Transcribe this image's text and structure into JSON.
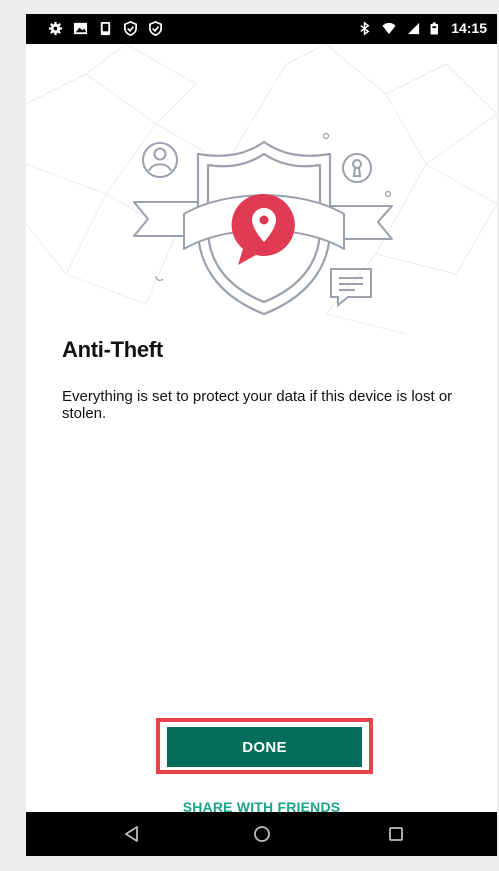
{
  "status_bar": {
    "time": "14:15",
    "left_icons": [
      "settings-icon",
      "image-icon",
      "device-icon",
      "shield-check-icon",
      "shield-check-icon"
    ],
    "right_icons": [
      "bluetooth-icon",
      "wifi-icon",
      "signal-icon",
      "battery-icon"
    ]
  },
  "screen": {
    "title": "Anti-Theft",
    "description": "Everything is set to protect your data if this device is lost or stolen."
  },
  "actions": {
    "done_label": "DONE",
    "share_label": "SHARE WITH FRIENDS"
  },
  "nav": {
    "icons": [
      "back-icon",
      "home-icon",
      "recents-icon"
    ]
  },
  "colors": {
    "accent_primary": "#046c5a",
    "accent_link": "#1aa58a",
    "brand_pin": "#e13a55",
    "highlight": "#e8434a"
  }
}
